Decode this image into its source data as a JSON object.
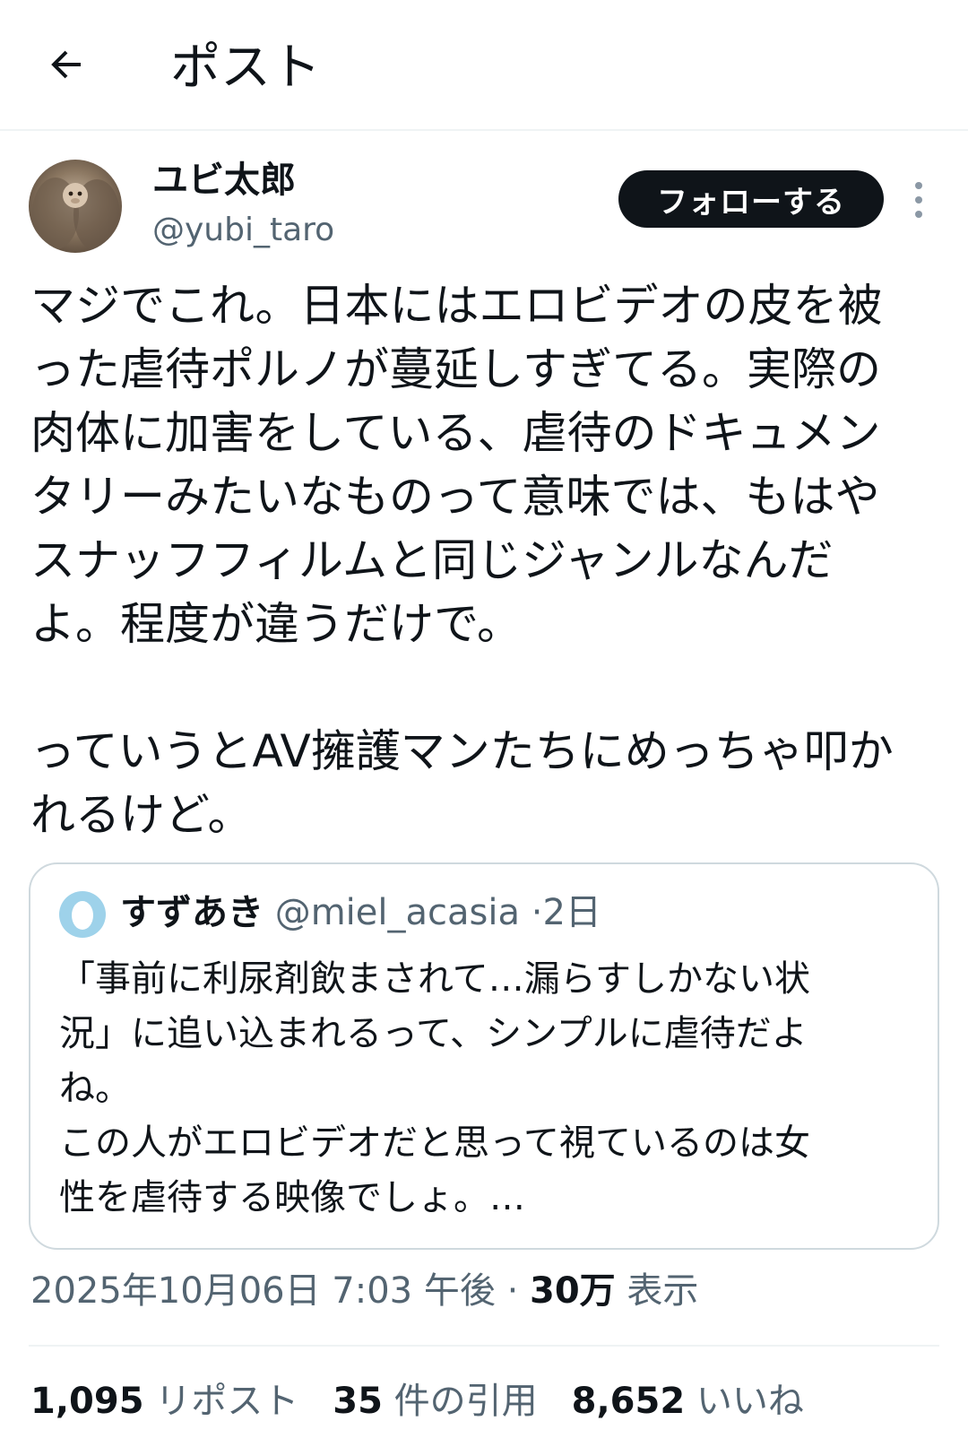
{
  "header": {
    "back_icon": "arrow-left-icon",
    "title": "ポスト"
  },
  "author": {
    "name": "ユビ太郎",
    "handle": "@yubi_taro",
    "follow_label": "フォローする",
    "more_icon": "more-vertical-icon"
  },
  "post": {
    "text": "マジでこれ。日本にはエロビデオの皮を被\nった虐待ポルノが蔓延しすぎてる。実際の\n肉体に加害をしている、虐待のドキュメン\nタリーみたいなものって意味では、もはや\nスナッフフィルムと同じジャンルなんだ\nよ。程度が違うだけで。\n\nっていうとAV擁護マンたちにめっちゃ叩か\nれるけど。"
  },
  "quote": {
    "name": "すずあき",
    "handle": "@miel_acasia",
    "separator": "·",
    "time": "2日",
    "text": "「事前に利尿剤飲まされて…漏らすしかない状\n況」に追い込まれるって、シンプルに虐待だよ\nね。\nこの人がエロビデオだと思って視ているのは女\n性を虐待する映像でしょ。…"
  },
  "meta": {
    "timestamp": "2025年10月06日 7:03 午後",
    "separator": "·",
    "views_count": "30万",
    "views_label": "表示"
  },
  "stats": {
    "reposts_count": "1,095",
    "reposts_label": "リポスト",
    "quotes_count": "35",
    "quotes_label": "件の引用",
    "likes_count": "8,652",
    "likes_label": "いいね"
  },
  "colors": {
    "text": "#0f1419",
    "secondary": "#536471",
    "border": "#cfd9de",
    "divider": "#eff3f4",
    "button_bg": "#0f1419"
  }
}
